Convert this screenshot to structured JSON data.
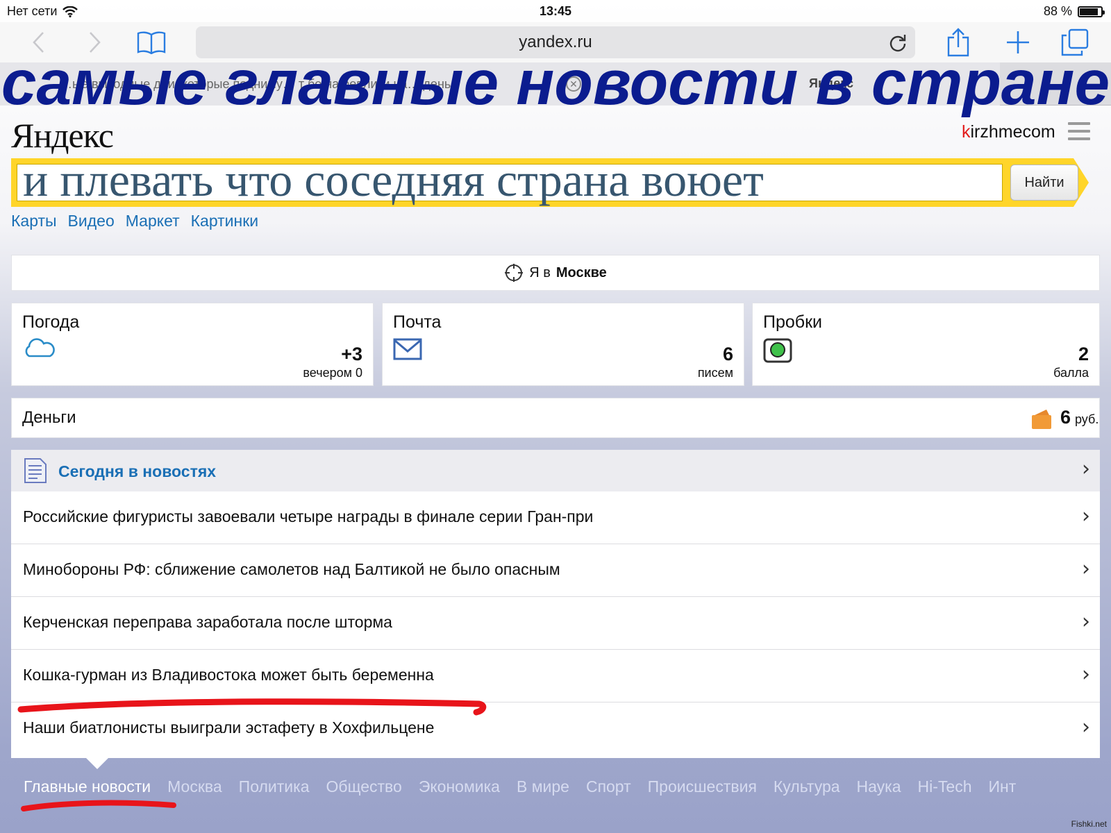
{
  "status_bar": {
    "network": "Нет сети",
    "time": "13:45",
    "battery_percent": "88 %",
    "battery_level": 0.88
  },
  "browser": {
    "url": "yandex.ru",
    "tab_active_title": "…ые выходные дни, которые подниму… т бе на реплики на… день",
    "tab_other_title": "Яндекс"
  },
  "caption_top": "самые главные новости в стране",
  "header": {
    "logo": "Яндекс",
    "username_first": "k",
    "username_rest": "irzhmecom"
  },
  "search": {
    "value": "и плевать что соседняя страна воюет",
    "button": "Найти"
  },
  "services": [
    "Карты",
    "Видео",
    "Маркет",
    "Картинки"
  ],
  "geo": {
    "prefix": "Я в",
    "city": "Москве"
  },
  "weather": {
    "title": "Погода",
    "value": "+3",
    "sub": "вечером 0"
  },
  "mail": {
    "title": "Почта",
    "value": "6",
    "sub": "писем"
  },
  "traffic": {
    "title": "Пробки",
    "value": "2",
    "sub": "балла"
  },
  "money": {
    "title": "Деньги",
    "amount": "6",
    "currency": "руб."
  },
  "news": {
    "title": "Сегодня в новостях",
    "items": [
      "Российские фигуристы завоевали четыре награды в финале серии Гран-при",
      "Минобороны РФ: сближение самолетов над Балтикой не было опасным",
      "Керченская переправа заработала после шторма",
      "Кошка-гурман из Владивостока может быть беременна",
      "Наши биатлонисты выиграли эстафету в Хохфильцене"
    ]
  },
  "categories": [
    "Главные новости",
    "Москва",
    "Политика",
    "Общество",
    "Экономика",
    "В мире",
    "Спорт",
    "Происшествия",
    "Культура",
    "Наука",
    "Hi-Tech",
    "Инт"
  ],
  "watermark": "Fishki.net",
  "colors": {
    "accent_blue": "#1a6fb5",
    "yandex_red": "#e21b1b",
    "search_yellow": "#ffd52a",
    "caption_blue": "#0b1c8f",
    "annotation_red": "#e8141a"
  },
  "icons": [
    "wifi-icon",
    "back-icon",
    "forward-icon",
    "bookmarks-icon",
    "reload-icon",
    "share-icon",
    "new-tab-icon",
    "tabs-icon",
    "locate-icon",
    "cloud-icon",
    "mail-icon",
    "traffic-icon",
    "wallet-icon",
    "news-doc-icon",
    "chevron-right-icon",
    "menu-icon"
  ]
}
